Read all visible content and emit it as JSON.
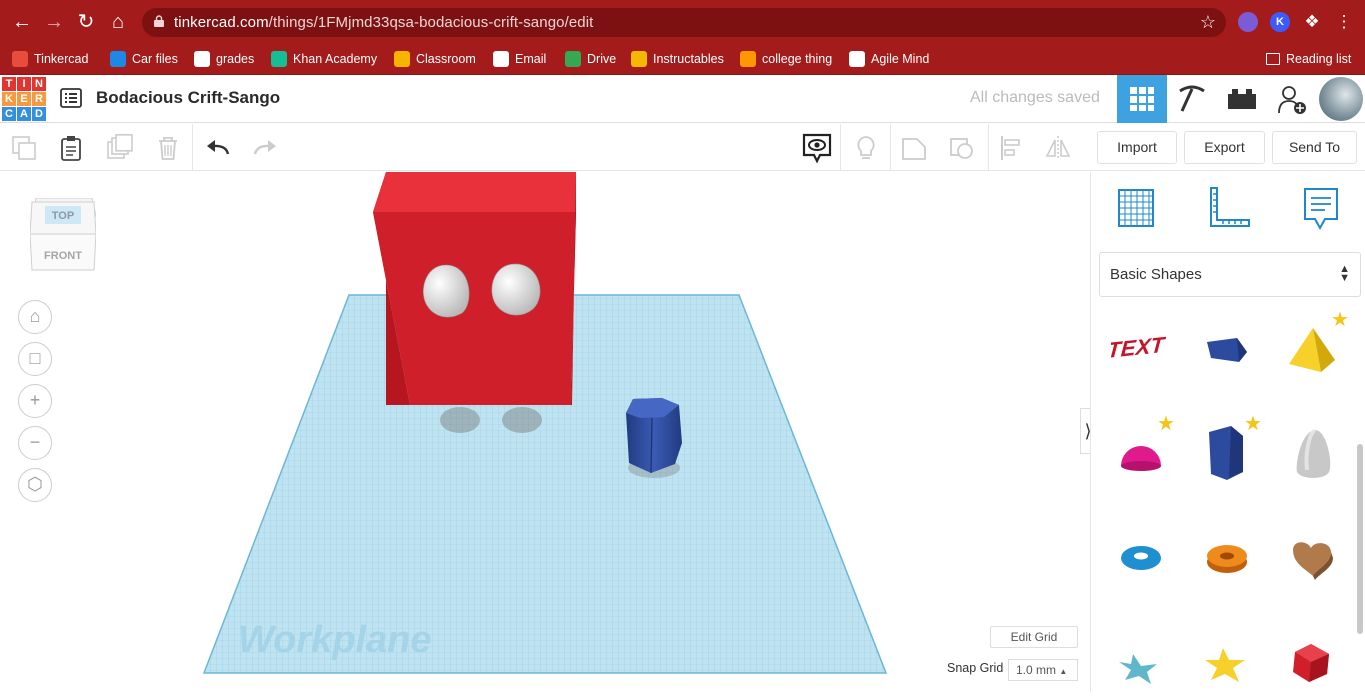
{
  "browser": {
    "url_domain": "tinkercad.com",
    "url_path": "/things/1FMjmd33qsa-bodacious-crift-sango/edit"
  },
  "bookmarks": [
    {
      "label": "Tinkercad",
      "color": "#e74c3c"
    },
    {
      "label": "Car files",
      "color": "#1e88e5"
    },
    {
      "label": "grades",
      "color": "#ffffff"
    },
    {
      "label": "Khan Academy",
      "color": "#14bf96"
    },
    {
      "label": "Classroom",
      "color": "#f4b400"
    },
    {
      "label": "Email",
      "color": "#ffffff"
    },
    {
      "label": "Drive",
      "color": "#34a853"
    },
    {
      "label": "Instructables",
      "color": "#f5b800"
    },
    {
      "label": "college thing",
      "color": "#ff9800"
    },
    {
      "label": "Agile Mind",
      "color": "#ffffff"
    }
  ],
  "reading_list": "Reading list",
  "app": {
    "logo_letters": [
      "T",
      "I",
      "N",
      "K",
      "E",
      "R",
      "C",
      "A",
      "D"
    ],
    "title": "Bodacious Crift-Sango",
    "save_status": "All changes saved"
  },
  "toolbar": {
    "import": "Import",
    "export": "Export",
    "send_to": "Send To"
  },
  "viewcube": {
    "top": "TOP",
    "front": "FRONT"
  },
  "workplane": {
    "label": "Workplane"
  },
  "panel": {
    "library": "Basic Shapes",
    "favorite_icon": "★"
  },
  "grid": {
    "edit": "Edit Grid",
    "snap_label": "Snap Grid",
    "snap_value": "1.0 mm"
  },
  "colors": {
    "browser_chrome": "#a31b1b",
    "accent_blue": "#1e88c8",
    "box_red": "#d61f2a",
    "shape_navy": "#2f4f9e"
  }
}
